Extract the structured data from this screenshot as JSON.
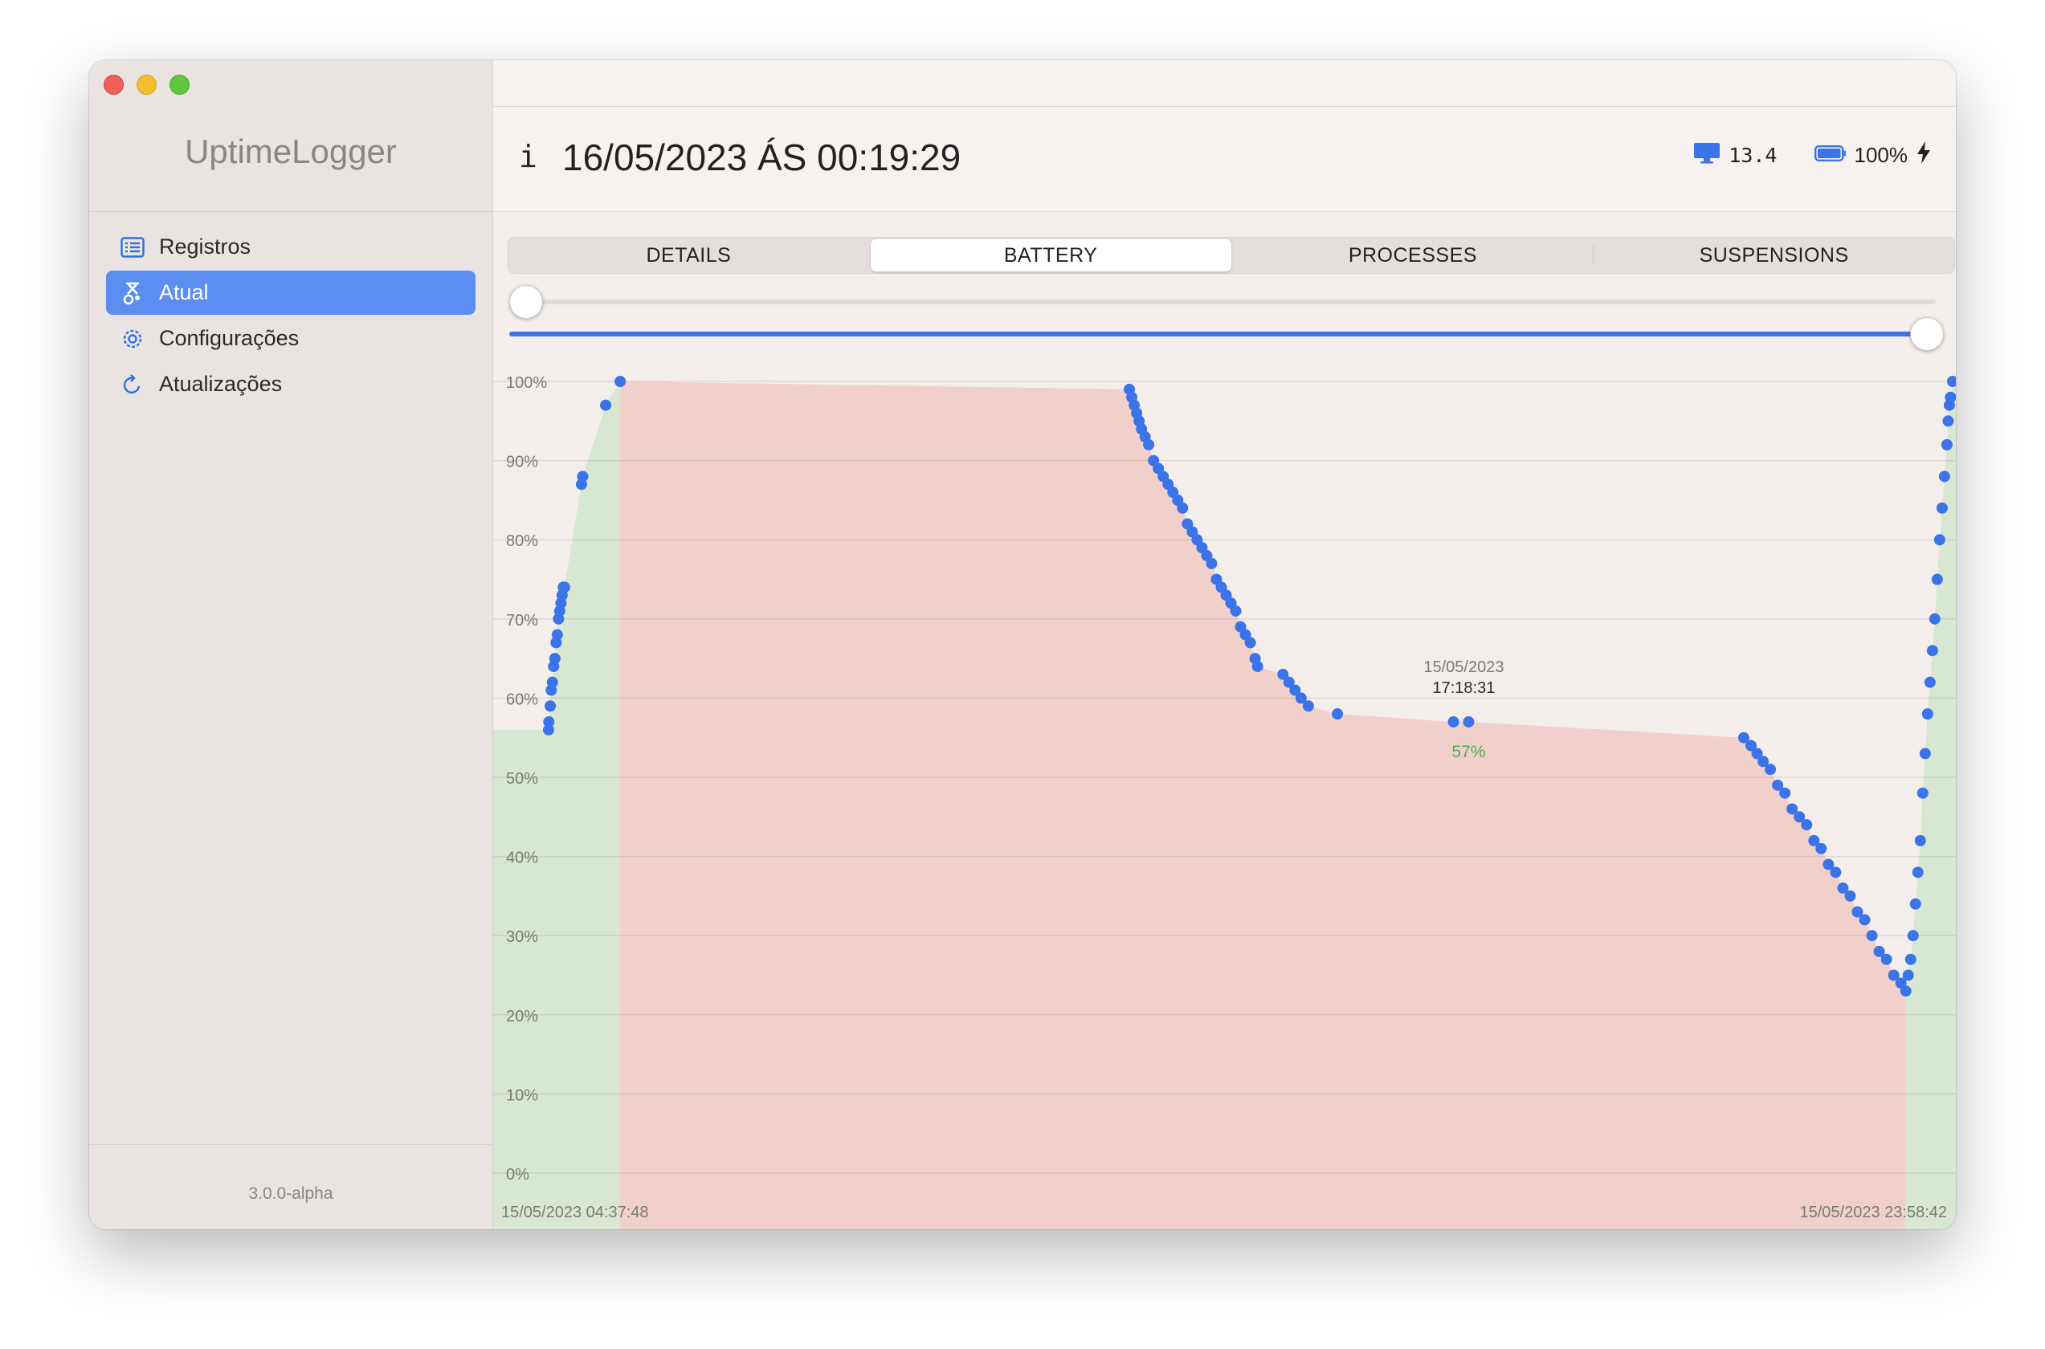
{
  "app": {
    "title": "UptimeLogger",
    "version": "3.0.0-alpha",
    "window_controls": [
      "close",
      "minimize",
      "zoom"
    ]
  },
  "sidebar": {
    "items": [
      {
        "label": "Registros",
        "icon": "list-icon",
        "active": false
      },
      {
        "label": "Atual",
        "icon": "stopwatch-icon",
        "active": true
      },
      {
        "label": "Configurações",
        "icon": "gear-icon",
        "active": false
      },
      {
        "label": "Atualizações",
        "icon": "refresh-icon",
        "active": false
      }
    ]
  },
  "header": {
    "info_icon_label": "i",
    "title": "16/05/2023 ÁS 00:19:29",
    "os_version": "13.4",
    "battery_percent": "100%",
    "icons": [
      "display-icon",
      "battery-icon",
      "bolt-icon"
    ]
  },
  "tabs": {
    "items": [
      "DETAILS",
      "BATTERY",
      "PROCESSES",
      "SUSPENSIONS"
    ],
    "selected": "BATTERY"
  },
  "range_slider": {
    "top_knob_value": 0,
    "bottom_range_value": [
      0,
      1
    ]
  },
  "colors": {
    "accent": "#5b8ef0",
    "point": "#3b74e8",
    "charging_fill": "#d8e7d2",
    "discharging_fill": "#f1d0cb",
    "tooltip_value": "#4cb14c"
  },
  "chart_data": {
    "type": "scatter",
    "title": "",
    "xlabel": "",
    "ylabel": "",
    "y_ticks": [
      "100%",
      "90%",
      "80%",
      "70%",
      "60%",
      "50%",
      "40%",
      "30%",
      "20%",
      "10%",
      "0%"
    ],
    "ylim": [
      0,
      100
    ],
    "xlim": [
      "15/05/2023 04:37:48",
      "15/05/2023 23:58:42"
    ],
    "x_start_label": "15/05/2023 04:37:48",
    "x_end_label": "15/05/2023 23:58:42",
    "grid": true,
    "series": [
      {
        "x": [
          "04:37:48",
          "04:38:00",
          "04:39:10",
          "04:40:00",
          "04:41:00",
          "04:42:00",
          "04:43:00",
          "04:44:00",
          "04:45:00",
          "04:46:00",
          "04:47:00",
          "04:48:00",
          "04:49:00",
          "04:50:00",
          "04:51:00",
          "05:05:00",
          "05:06:00",
          "05:25:00",
          "05:37:00",
          "12:38:00",
          "12:40:00",
          "12:42:00",
          "12:44:00",
          "12:46:00",
          "12:48:00",
          "12:51:00",
          "12:54:00",
          "12:58:00",
          "13:02:00",
          "13:06:00",
          "13:10:00",
          "13:14:00",
          "13:18:00",
          "13:22:00",
          "13:26:00",
          "13:30:00",
          "13:34:00",
          "13:38:00",
          "13:42:00",
          "13:46:00",
          "13:50:00",
          "13:54:00",
          "13:58:00",
          "14:02:00",
          "14:06:00",
          "14:10:00",
          "14:14:00",
          "14:18:00",
          "14:22:00",
          "14:24:00",
          "14:45:00",
          "14:50:00",
          "14:55:00",
          "15:00:00",
          "15:06:00",
          "15:30:00",
          "17:06:00",
          "17:18:31",
          "21:06:00",
          "21:12:00",
          "21:17:00",
          "21:22:00",
          "21:28:00",
          "21:34:00",
          "21:40:00",
          "21:46:00",
          "21:52:00",
          "21:58:00",
          "22:04:00",
          "22:10:00",
          "22:16:00",
          "22:22:00",
          "22:28:00",
          "22:34:00",
          "22:40:00",
          "22:46:00",
          "22:52:00",
          "22:58:00",
          "23:04:00",
          "23:10:00",
          "23:16:00",
          "23:20:00",
          "23:22:00",
          "23:24:00",
          "23:26:00",
          "23:28:00",
          "23:30:00",
          "23:32:00",
          "23:34:00",
          "23:36:00",
          "23:38:00",
          "23:40:00",
          "23:42:00",
          "23:44:00",
          "23:46:00",
          "23:48:00",
          "23:50:00",
          "23:52:00",
          "23:54:00",
          "23:55:00",
          "23:56:00",
          "23:57:00",
          "23:58:42"
        ],
        "y": [
          56,
          57,
          59,
          61,
          62,
          64,
          65,
          67,
          68,
          70,
          71,
          72,
          73,
          74,
          74,
          87,
          88,
          97,
          100,
          99,
          98,
          97,
          96,
          95,
          94,
          93,
          92,
          90,
          89,
          88,
          87,
          86,
          85,
          84,
          82,
          81,
          80,
          79,
          78,
          77,
          75,
          74,
          73,
          72,
          71,
          69,
          68,
          67,
          65,
          64,
          63,
          62,
          61,
          60,
          59,
          58,
          57,
          57,
          55,
          54,
          53,
          52,
          51,
          49,
          48,
          46,
          45,
          44,
          42,
          41,
          39,
          38,
          36,
          35,
          33,
          32,
          30,
          28,
          27,
          25,
          24,
          23,
          25,
          27,
          30,
          34,
          38,
          42,
          48,
          53,
          58,
          62,
          66,
          70,
          75,
          80,
          84,
          88,
          92,
          95,
          97,
          98,
          100
        ]
      }
    ],
    "regions": [
      {
        "state": "charging",
        "from": "04:37:48",
        "to": "05:37:00"
      },
      {
        "state": "discharging",
        "from": "05:37:00",
        "to": "23:20:00"
      },
      {
        "state": "charging",
        "from": "23:20:00",
        "to": "23:58:42"
      }
    ],
    "tooltip": {
      "date": "15/05/2023",
      "time": "17:18:31",
      "value": "57%"
    }
  }
}
